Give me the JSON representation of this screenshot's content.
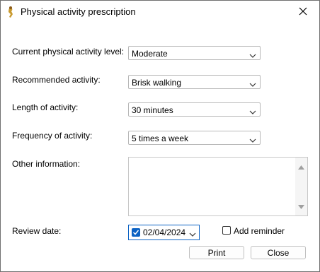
{
  "window": {
    "title": "Physical activity prescription"
  },
  "form": {
    "current_level": {
      "label": "Current physical activity level:",
      "value": "Moderate"
    },
    "recommended": {
      "label": "Recommended activity:",
      "value": "Brisk walking"
    },
    "length": {
      "label": "Length of activity:",
      "value": "30 minutes"
    },
    "frequency": {
      "label": "Frequency of activity:",
      "value": "5 times a week"
    },
    "other": {
      "label": "Other information:",
      "value": ""
    },
    "review": {
      "label": "Review date:",
      "date": "02/04/2024",
      "enabled": true
    }
  },
  "reminder": {
    "label": "Add reminder",
    "checked": false
  },
  "buttons": {
    "print": "Print",
    "close": "Close"
  },
  "colors": {
    "accent": "#0b62c4",
    "border": "#b8b8b8"
  },
  "icons": [
    "app-icon",
    "close-icon",
    "chevron-down-icon",
    "check-icon",
    "scroll-up-icon",
    "scroll-down-icon"
  ]
}
